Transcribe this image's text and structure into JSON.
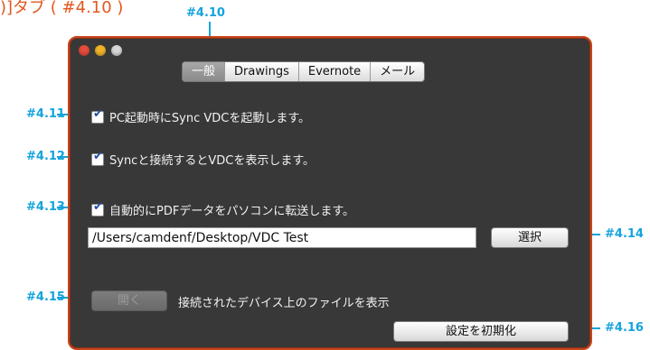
{
  "page_heading": ")]タブ ( #4.10 )",
  "annotations": {
    "tabs": "#4.10",
    "startup": "#4.11",
    "sync": "#4.12",
    "transfer": "#4.13",
    "select": "#4.14",
    "open": "#4.15",
    "reset": "#4.16"
  },
  "window": {
    "traffic_lights": [
      "close",
      "minimize",
      "zoom"
    ],
    "tabs": [
      {
        "label": "一般",
        "active": true
      },
      {
        "label": "Drawings",
        "active": false
      },
      {
        "label": "Evernote",
        "active": false
      },
      {
        "label": "メール",
        "active": false
      }
    ],
    "options": {
      "startup_label": "PC起動時にSync VDCを起動します。",
      "sync_label": "Syncと接続するとVDCを表示します。",
      "transfer_label": "自動的にPDFデータをパソコンに転送します。"
    },
    "path_value": "/Users/camdenf/Desktop/VDC Test",
    "select_button": "選択",
    "open_button": "開く",
    "open_description": "接続されたデバイス上のファイルを表示",
    "reset_button": "設定を初期化"
  },
  "colors": {
    "annotation": "#14a3dd",
    "heading": "#e2571f",
    "window_border": "#c6451c",
    "window_bg": "#383838"
  }
}
